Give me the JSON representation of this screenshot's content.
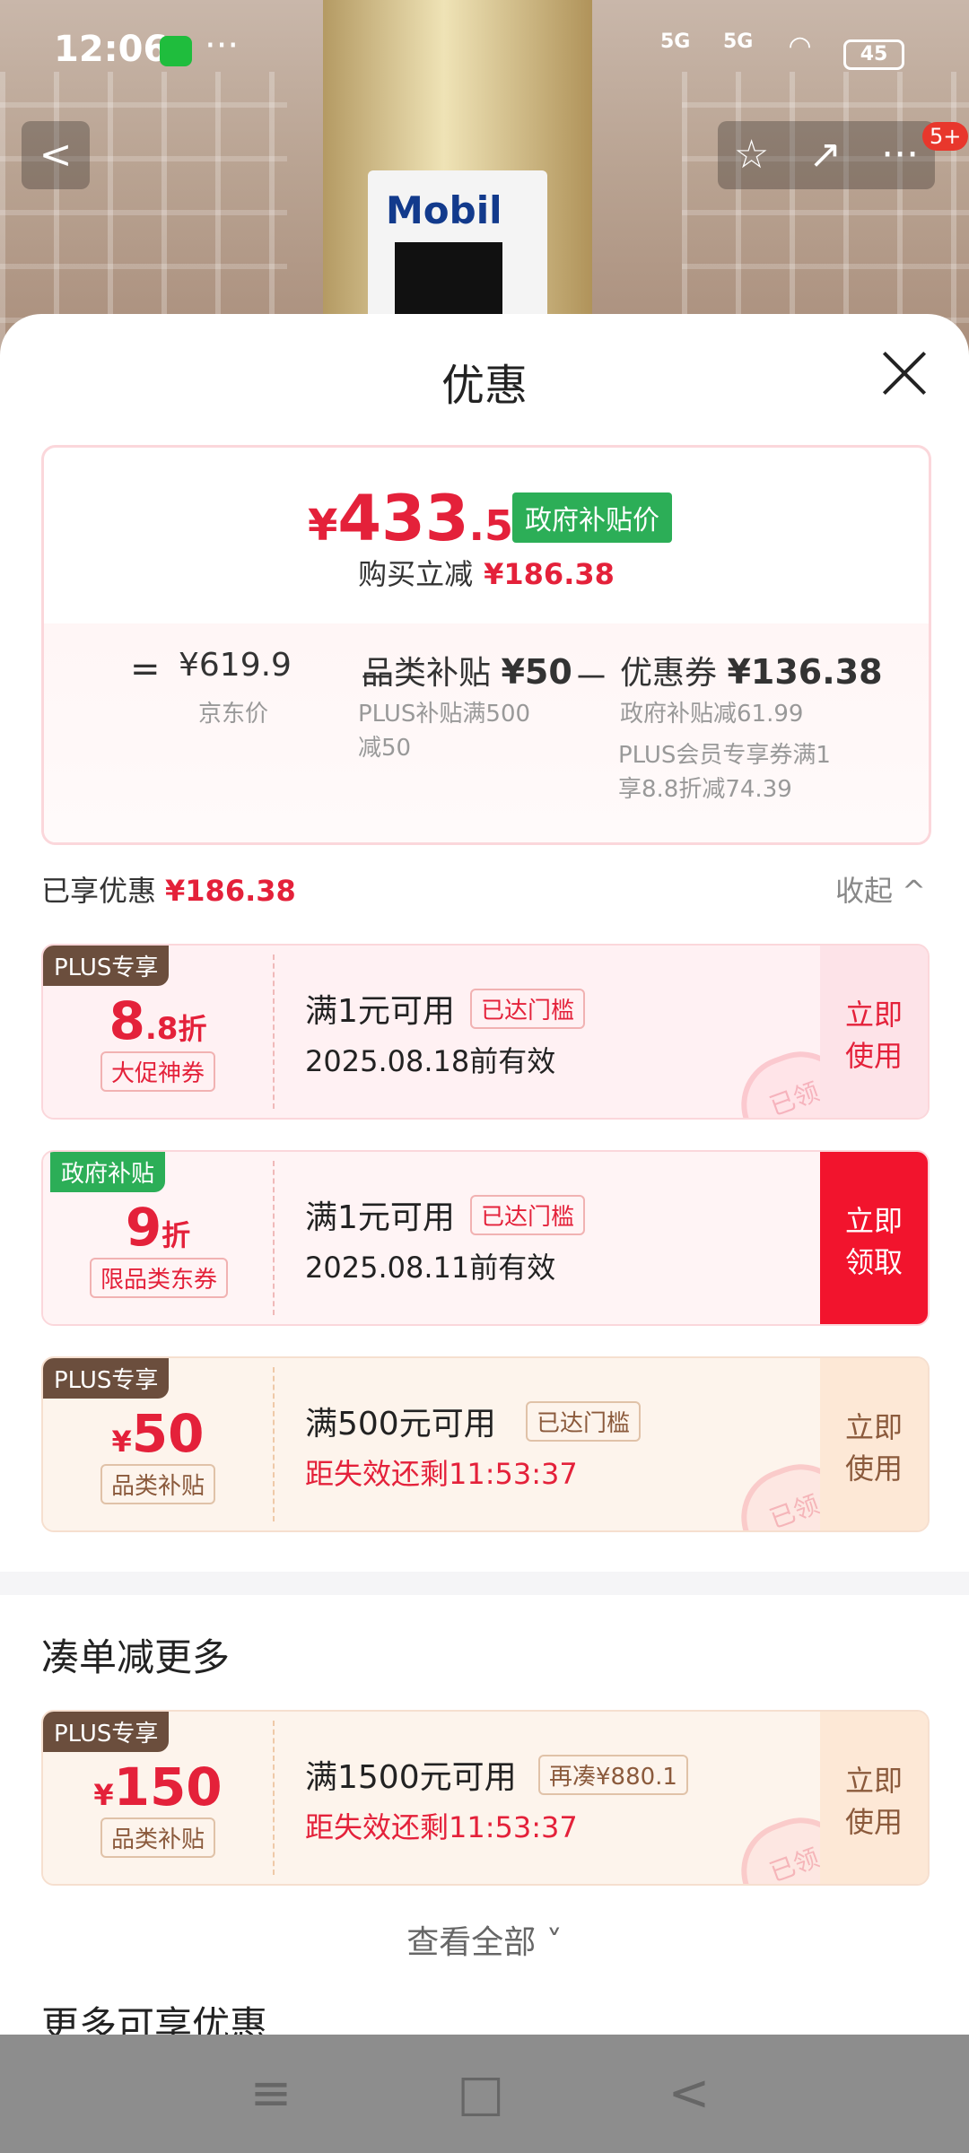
{
  "status_bar": {
    "time": "12:06",
    "more": "···",
    "signal1": "5G",
    "signal2": "5G",
    "battery": "45"
  },
  "header": {
    "back": "<",
    "star": "☆",
    "share": "↗",
    "more": "···",
    "badge": "5+"
  },
  "product_bg": {
    "brand": "Mobil",
    "model": "1"
  },
  "sheet": {
    "title": "优惠",
    "price": {
      "currency": "¥",
      "integer": "433",
      "decimal": ".52",
      "gov_tag": "政府补贴价",
      "buy_label": "购买立减",
      "buy_amount": "¥186.38",
      "equals": "=",
      "jd_price": "¥619.9",
      "jd_label": "京东价",
      "minus1": "－",
      "cat_label": "品类补贴",
      "cat_value": "¥50",
      "cat_sub": "PLUS补贴满500减50",
      "minus2": "－",
      "coupon_label": "优惠券",
      "coupon_value": "¥136.38",
      "coupon_sub1": "政府补贴减61.99",
      "coupon_sub2": "PLUS会员专享券满1享8.8折减74.39"
    },
    "enjoyed": {
      "label": "已享优惠",
      "amount": "¥186.38",
      "collapse": "收起 ^"
    },
    "coupons": [
      {
        "tag": "PLUS专享",
        "big_int": "8",
        "big_dec": ".8",
        "unit": "折",
        "kind": "大促神券",
        "cond": "满1元可用",
        "pill": "已达门槛",
        "sub": "2025.08.18前有效",
        "act1": "立即",
        "act2": "使用",
        "stamp": "已领"
      },
      {
        "tag": "政府补贴",
        "big_int": "9",
        "unit": "折",
        "kind": "限品类东券",
        "cond": "满1元可用",
        "pill": "已达门槛",
        "sub": "2025.08.11前有效",
        "act1": "立即",
        "act2": "领取"
      },
      {
        "tag": "PLUS专享",
        "cur": "¥",
        "big_int": "50",
        "kind": "品类补贴",
        "cond": "满500元可用",
        "pill": "已达门槛",
        "sub": "距失效还剩11:53:37",
        "act1": "立即",
        "act2": "使用",
        "stamp": "已领"
      }
    ],
    "more_section": {
      "title": "凑单减更多",
      "coupon": {
        "tag": "PLUS专享",
        "cur": "¥",
        "big_int": "150",
        "kind": "品类补贴",
        "cond": "满1500元可用",
        "pill": "再凑¥880.1",
        "sub": "距失效还剩11:53:37",
        "act1": "立即",
        "act2": "使用",
        "stamp": "已领"
      },
      "see_all": "查看全部 ˅"
    },
    "next_title": "更多可享优惠"
  },
  "nav": {
    "menu": "≡",
    "home": "□",
    "back": "<"
  }
}
